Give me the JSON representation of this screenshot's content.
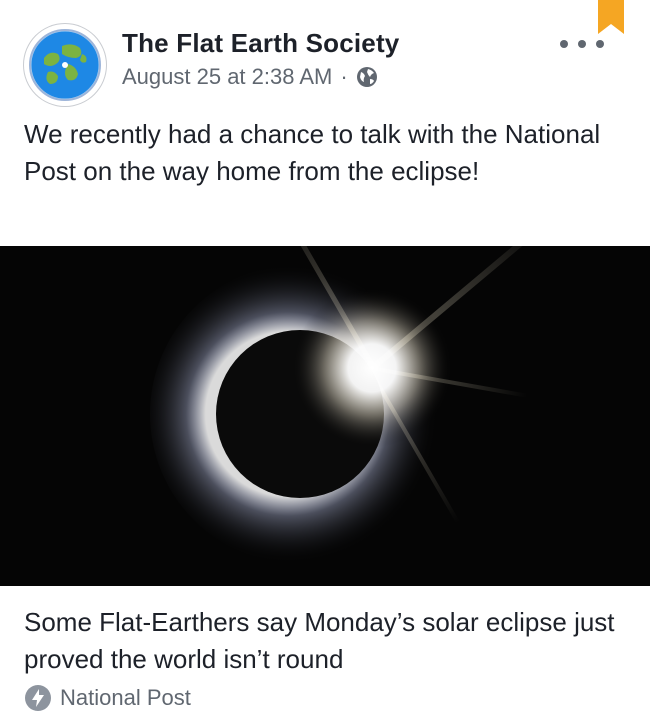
{
  "post": {
    "page_name": "The Flat Earth Society",
    "timestamp": "August 25 at 2:38 AM",
    "separator": "·",
    "privacy_icon": "globe-icon",
    "more_icon": "more-options-icon",
    "bookmark_icon": "bookmark-icon",
    "text": "We recently had a chance to talk with the National Post on the way home from the eclipse!"
  },
  "link_preview": {
    "image": "solar-eclipse-diamond-ring-photo",
    "title": "Some Flat-Earthers say Monday’s solar eclipse just proved the world isn’t round",
    "source_icon": "instant-article-bolt-icon",
    "source": "National Post"
  },
  "colors": {
    "text_primary": "#1d2129",
    "text_secondary": "#606770",
    "bookmark": "#f5a623",
    "logo_ocean": "#1e88e5",
    "logo_land": "#7cb342"
  }
}
